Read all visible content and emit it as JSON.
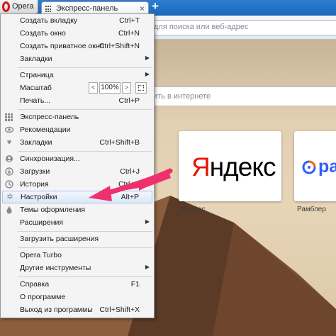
{
  "browser": {
    "opera_button": "Opera",
    "tab_title": "Экспресс-панель",
    "tab_close": "×",
    "new_tab": "+",
    "address_placeholder": "для поиска или веб-адрес"
  },
  "speed_dial": {
    "search_placeholder": "ить в интернете",
    "tiles": [
      {
        "caption": "Яндекс",
        "logo_first": "Я",
        "logo_rest": "ндекс"
      },
      {
        "caption": "Рамблер",
        "logo_word": "ра"
      }
    ]
  },
  "menu": {
    "items": [
      {
        "label": "Создать вкладку",
        "shortcut": "Ctrl+T"
      },
      {
        "label": "Создать окно",
        "shortcut": "Ctrl+N"
      },
      {
        "label": "Создать приватное окно",
        "shortcut": "Ctrl+Shift+N"
      },
      {
        "label": "Закладки",
        "submenu": "▶"
      },
      {
        "label": "Страница",
        "submenu": "▶"
      },
      {
        "label": "Масштаб",
        "zoom": "100%",
        "zoom_minus": "<",
        "zoom_plus": ">"
      },
      {
        "label": "Печать...",
        "shortcut": "Ctrl+P"
      },
      {
        "label": "Экспресс-панель",
        "icon": "speed-dial-icon"
      },
      {
        "label": "Рекомендации",
        "icon": "eye-icon"
      },
      {
        "label": "Закладки",
        "shortcut": "Ctrl+Shift+B",
        "icon": "heart-icon"
      },
      {
        "label": "Синхронизация...",
        "icon": "sync-icon"
      },
      {
        "label": "Загрузки",
        "shortcut": "Ctrl+J",
        "icon": "download-icon"
      },
      {
        "label": "История",
        "shortcut": "Ctrl+H",
        "icon": "clock-icon"
      },
      {
        "label": "Настройки",
        "shortcut": "Alt+P",
        "icon": "gear-icon"
      },
      {
        "label": "Темы оформления",
        "icon": "drop-icon"
      },
      {
        "label": "Расширения",
        "submenu": "▶"
      },
      {
        "label": "Загрузить расширения"
      },
      {
        "label": "Opera Turbo"
      },
      {
        "label": "Другие инструменты",
        "submenu": "▶"
      },
      {
        "label": "Справка",
        "shortcut": "F1"
      },
      {
        "label": "О программе"
      },
      {
        "label": "Выход из программы",
        "shortcut": "Ctrl+Shift+X"
      }
    ]
  },
  "colors": {
    "annotation_arrow": "#f0306d",
    "opera_red": "#cc1a1a",
    "yandex_red": "#e61400",
    "rambler_blue": "#315efb"
  }
}
